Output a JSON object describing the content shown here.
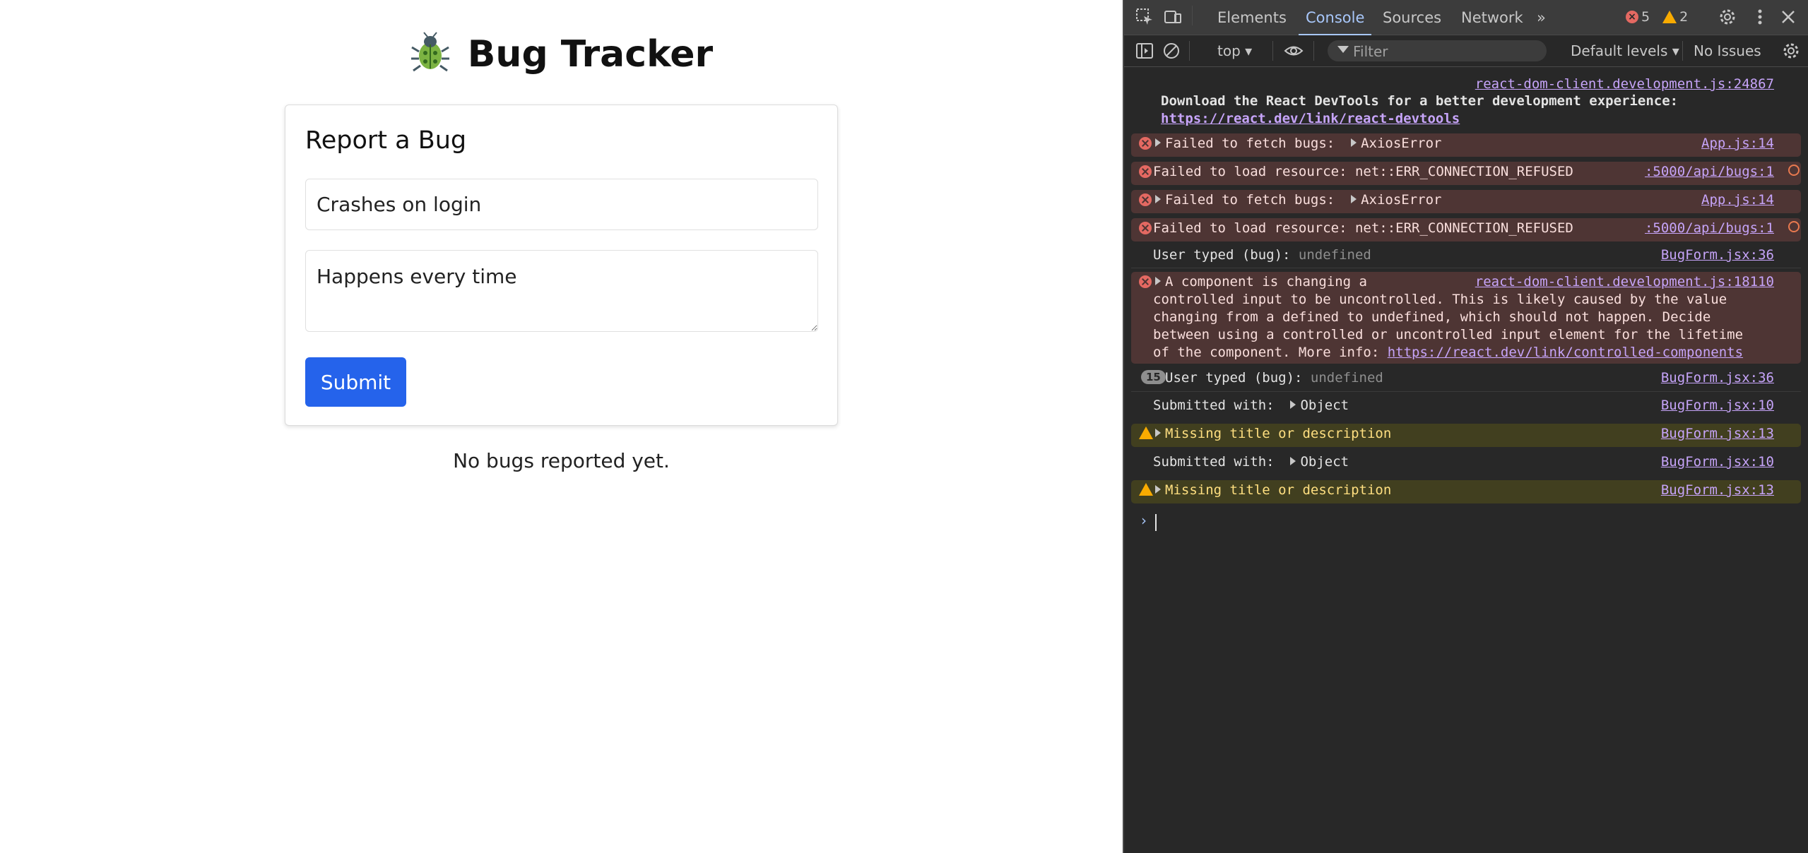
{
  "app": {
    "title": "Bug Tracker",
    "form": {
      "heading": "Report a Bug",
      "title_value": "Crashes on login",
      "description_value": "Happens every time",
      "submit_label": "Submit"
    },
    "empty_message": "No bugs reported yet."
  },
  "devtools": {
    "tabs": [
      "Elements",
      "Console",
      "Sources",
      "Network"
    ],
    "active_tab": "Console",
    "error_count": "5",
    "warning_count": "2",
    "context": "top",
    "filter_placeholder": "Filter",
    "levels": "Default levels",
    "issues": "No Issues",
    "messages": [
      {
        "level": "info",
        "source": "react-dom-client.development.js:24867",
        "text": "Download the React DevTools for a better development experience:",
        "link": "https://react.dev/link/react-devtools"
      },
      {
        "level": "error",
        "text": "Failed to fetch bugs:",
        "object": "AxiosError",
        "source": "App.js:14"
      },
      {
        "level": "error",
        "text": "Failed to load resource: net::ERR_CONNECTION_REFUSED",
        "source": ":5000/api/bugs:1"
      },
      {
        "level": "error",
        "text": "Failed to fetch bugs:",
        "object": "AxiosError",
        "source": "App.js:14"
      },
      {
        "level": "error",
        "text": "Failed to load resource: net::ERR_CONNECTION_REFUSED",
        "source": ":5000/api/bugs:1"
      },
      {
        "level": "log",
        "text": "User typed (bug):",
        "value": "undefined",
        "source": "BugForm.jsx:36"
      },
      {
        "level": "error",
        "source": "react-dom-client.development.js:18110",
        "lines": [
          "A component is changing a",
          "controlled input to be uncontrolled. This is likely caused by the value",
          "changing from a defined to undefined, which should not happen. Decide",
          "between using a controlled or uncontrolled input element for the lifetime",
          "of the component. More info: "
        ],
        "link": "https://react.dev/link/controlled-components"
      },
      {
        "level": "log",
        "repeat": "15",
        "text": "User typed (bug):",
        "value": "undefined",
        "source": "BugForm.jsx:36"
      },
      {
        "level": "log",
        "text": "Submitted with:",
        "object": "Object",
        "source": "BugForm.jsx:10"
      },
      {
        "level": "warning",
        "text": "Missing title or description",
        "source": "BugForm.jsx:13"
      },
      {
        "level": "log",
        "text": "Submitted with:",
        "object": "Object",
        "source": "BugForm.jsx:10"
      },
      {
        "level": "warning",
        "text": "Missing title or description",
        "source": "BugForm.jsx:13"
      }
    ],
    "prompt": "›"
  },
  "colors": {
    "submit_button": "#2563eb",
    "devtools_bg": "#282828",
    "error_row_bg": "#4e3534",
    "warning_row_bg": "#413f1f",
    "link": "#c6a4f9"
  },
  "icons": [
    "bug-icon",
    "inspect-icon",
    "device-toolbar-icon",
    "more-tabs-icon",
    "error-icon",
    "warning-icon",
    "settings-icon",
    "kebab-menu-icon",
    "close-icon",
    "sidebar-toggle-icon",
    "clear-console-icon",
    "eye-icon",
    "filter-icon",
    "expand-triangle-icon",
    "network-request-icon"
  ]
}
